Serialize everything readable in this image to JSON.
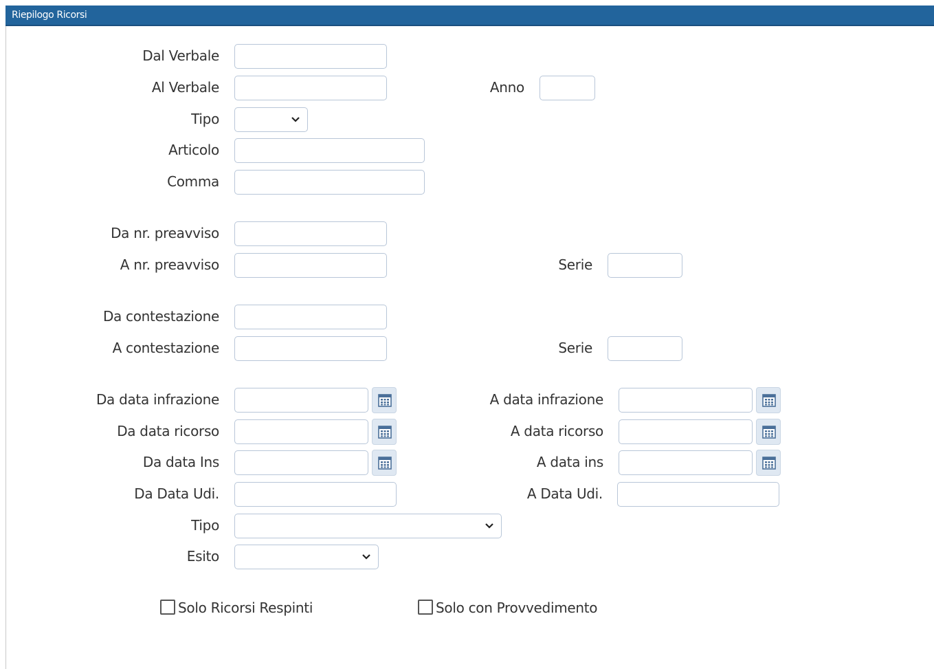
{
  "window": {
    "title": "Riepilogo Ricorsi"
  },
  "fields": {
    "dal_verbale": {
      "label": "Dal Verbale",
      "value": ""
    },
    "al_verbale": {
      "label": "Al Verbale",
      "value": ""
    },
    "anno": {
      "label": "Anno",
      "value": ""
    },
    "tipo_verbale": {
      "label": "Tipo",
      "selected": ""
    },
    "articolo": {
      "label": "Articolo",
      "value": ""
    },
    "comma": {
      "label": "Comma",
      "value": ""
    },
    "da_nr_preavviso": {
      "label": "Da nr. preavviso",
      "value": ""
    },
    "a_nr_preavviso": {
      "label": "A nr. preavviso",
      "value": ""
    },
    "serie_preavviso": {
      "label": "Serie",
      "value": ""
    },
    "da_contestazione": {
      "label": "Da contestazione",
      "value": ""
    },
    "a_contestazione": {
      "label": "A contestazione",
      "value": ""
    },
    "serie_contestazione": {
      "label": "Serie",
      "value": ""
    },
    "da_data_infrazione": {
      "label": "Da data infrazione",
      "value": ""
    },
    "a_data_infrazione": {
      "label": "A data infrazione",
      "value": ""
    },
    "da_data_ricorso": {
      "label": "Da data ricorso",
      "value": ""
    },
    "a_data_ricorso": {
      "label": "A data ricorso",
      "value": ""
    },
    "da_data_ins": {
      "label": "Da data Ins",
      "value": ""
    },
    "a_data_ins": {
      "label": "A data ins",
      "value": ""
    },
    "da_data_udi": {
      "label": "Da Data Udi.",
      "value": ""
    },
    "a_data_udi": {
      "label": "A Data Udi.",
      "value": ""
    },
    "tipo_ricorso": {
      "label": "Tipo",
      "selected": ""
    },
    "esito": {
      "label": "Esito",
      "selected": ""
    }
  },
  "checkboxes": {
    "solo_respinti": {
      "label": "Solo Ricorsi Respinti",
      "checked": false
    },
    "solo_provvedimento": {
      "label": "Solo con Provvedimento",
      "checked": false
    }
  },
  "icons": {
    "calendar": "calendar-icon",
    "dropdown": "chevron-down-icon"
  },
  "colors": {
    "titlebar": "#22649c",
    "input_border": "#b8c6d8",
    "calendar_bg": "#dfe8f2"
  }
}
